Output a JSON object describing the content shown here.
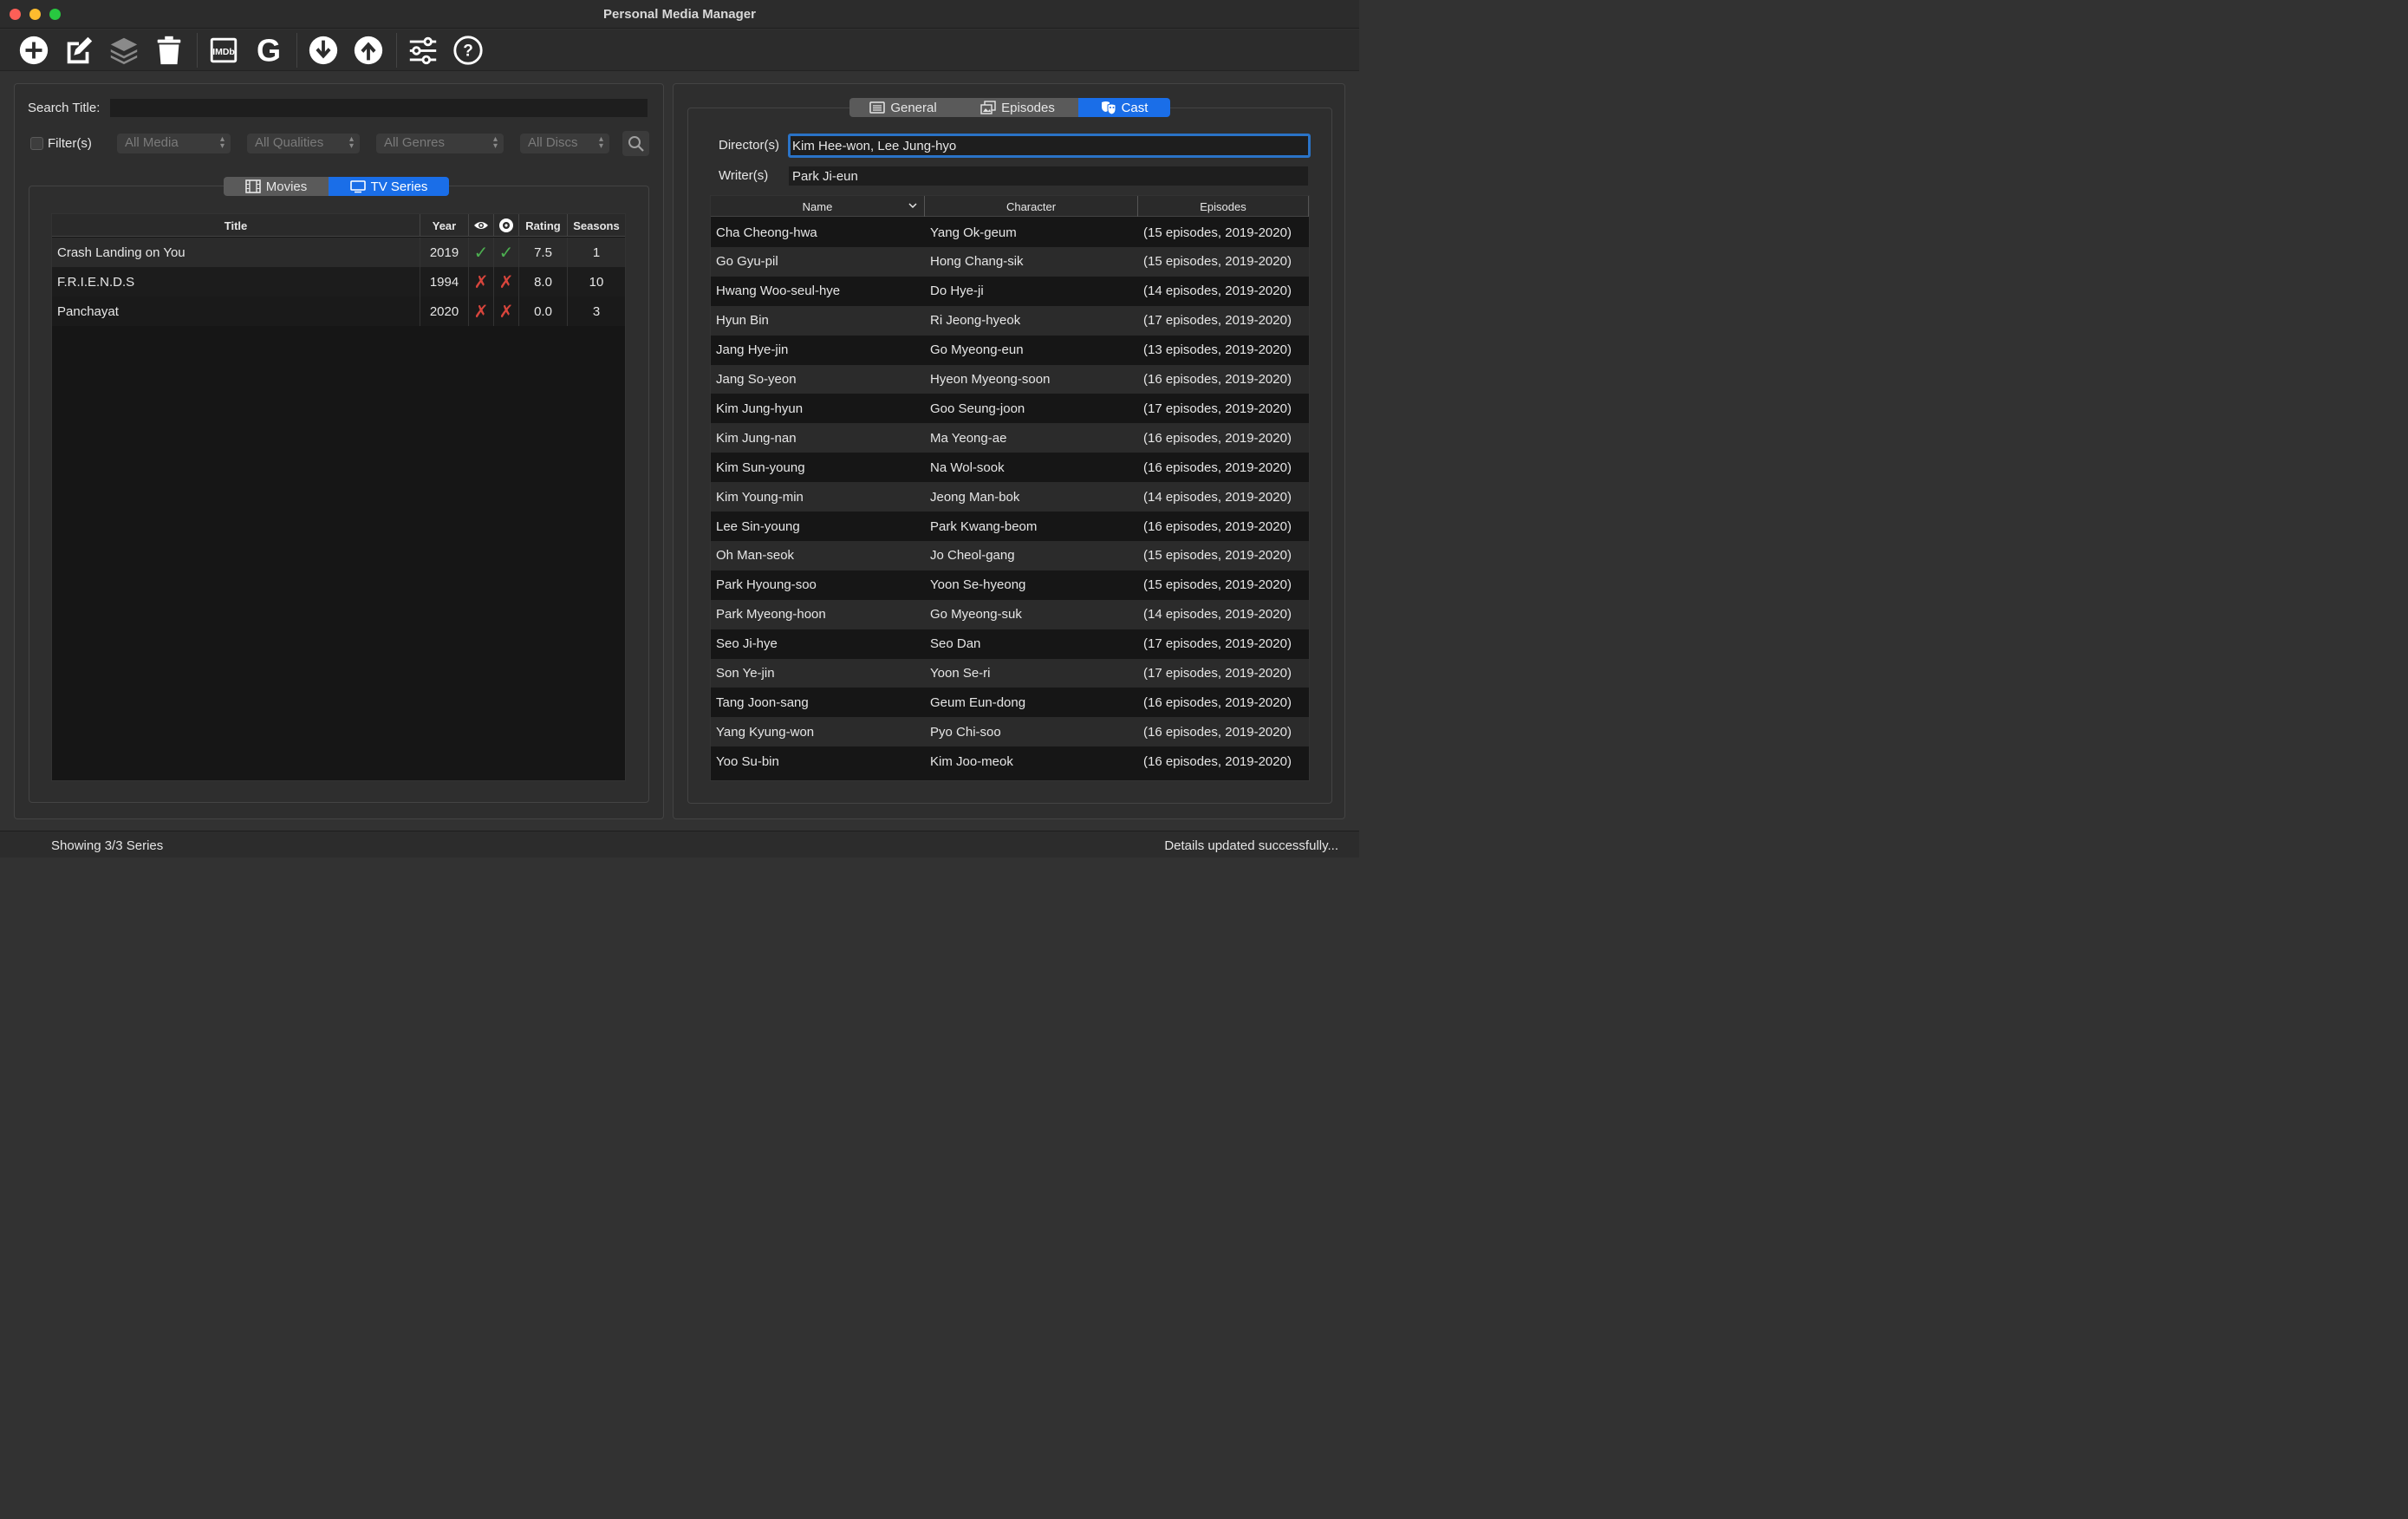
{
  "window": {
    "title": "Personal Media Manager"
  },
  "toolbar": {
    "buttons": [
      {
        "icon": "plus-circle-icon"
      },
      {
        "icon": "edit-icon"
      },
      {
        "icon": "layers-icon"
      },
      {
        "icon": "trash-icon"
      },
      {
        "icon": "imdb-icon",
        "label": "IMDb"
      },
      {
        "icon": "google-icon",
        "label": "G"
      },
      {
        "icon": "download-icon"
      },
      {
        "icon": "upload-icon"
      },
      {
        "icon": "sliders-icon"
      },
      {
        "icon": "help-icon"
      }
    ]
  },
  "search": {
    "label": "Search Title:",
    "value": ""
  },
  "filters": {
    "label": "Filter(s)",
    "checked": false,
    "media": "All Media",
    "qualities": "All Qualities",
    "genres": "All Genres",
    "discs": "All Discs"
  },
  "media_tabs": {
    "movies": "Movies",
    "tv_series": "TV Series",
    "active": "tv_series"
  },
  "series_table": {
    "headers": {
      "title": "Title",
      "year": "Year",
      "watched_icon": "eye-icon",
      "disc_icon": "disc-icon",
      "rating": "Rating",
      "seasons": "Seasons"
    },
    "rows": [
      {
        "title": "Crash Landing on You",
        "year": "2019",
        "watched": "✓",
        "owned": "✓",
        "rating": "7.5",
        "seasons": "1"
      },
      {
        "title": "F.R.I.E.N.D.S",
        "year": "1994",
        "watched": "✗",
        "owned": "✗",
        "rating": "8.0",
        "seasons": "10"
      },
      {
        "title": "Panchayat",
        "year": "2020",
        "watched": "✗",
        "owned": "✗",
        "rating": "0.0",
        "seasons": "3"
      }
    ]
  },
  "detail_tabs": {
    "general": "General",
    "episodes": "Episodes",
    "cast": "Cast",
    "active": "cast"
  },
  "credits": {
    "directors_label": "Director(s)",
    "directors_value": "Kim Hee-won, Lee Jung-hyo",
    "writers_label": "Writer(s)",
    "writers_value": "Park Ji-eun"
  },
  "cast_table": {
    "headers": {
      "name": "Name",
      "character": "Character",
      "episodes": "Episodes"
    },
    "rows": [
      {
        "name": "Cha Cheong-hwa",
        "character": "Yang Ok-geum",
        "episodes": "(15 episodes, 2019-2020)"
      },
      {
        "name": "Go Gyu-pil",
        "character": "Hong Chang-sik",
        "episodes": "(15 episodes, 2019-2020)"
      },
      {
        "name": "Hwang Woo-seul-hye",
        "character": "Do Hye-ji",
        "episodes": "(14 episodes, 2019-2020)"
      },
      {
        "name": "Hyun Bin",
        "character": "Ri Jeong-hyeok",
        "episodes": "(17 episodes, 2019-2020)"
      },
      {
        "name": "Jang Hye-jin",
        "character": "Go Myeong-eun",
        "episodes": "(13 episodes, 2019-2020)"
      },
      {
        "name": "Jang So-yeon",
        "character": "Hyeon Myeong-soon",
        "episodes": "(16 episodes, 2019-2020)"
      },
      {
        "name": "Kim Jung-hyun",
        "character": "Goo Seung-joon",
        "episodes": "(17 episodes, 2019-2020)"
      },
      {
        "name": "Kim Jung-nan",
        "character": "Ma Yeong-ae",
        "episodes": "(16 episodes, 2019-2020)"
      },
      {
        "name": "Kim Sun-young",
        "character": "Na Wol-sook",
        "episodes": "(16 episodes, 2019-2020)"
      },
      {
        "name": "Kim Young-min",
        "character": "Jeong Man-bok",
        "episodes": "(14 episodes, 2019-2020)"
      },
      {
        "name": "Lee Sin-young",
        "character": "Park Kwang-beom",
        "episodes": "(16 episodes, 2019-2020)"
      },
      {
        "name": "Oh Man-seok",
        "character": "Jo Cheol-gang",
        "episodes": "(15 episodes, 2019-2020)"
      },
      {
        "name": "Park Hyoung-soo",
        "character": "Yoon Se-hyeong",
        "episodes": "(15 episodes, 2019-2020)"
      },
      {
        "name": "Park Myeong-hoon",
        "character": "Go Myeong-suk",
        "episodes": "(14 episodes, 2019-2020)"
      },
      {
        "name": "Seo Ji-hye",
        "character": "Seo Dan",
        "episodes": "(17 episodes, 2019-2020)"
      },
      {
        "name": "Son Ye-jin",
        "character": "Yoon Se-ri",
        "episodes": "(17 episodes, 2019-2020)"
      },
      {
        "name": "Tang Joon-sang",
        "character": "Geum Eun-dong",
        "episodes": "(16 episodes, 2019-2020)"
      },
      {
        "name": "Yang Kyung-won",
        "character": "Pyo Chi-soo",
        "episodes": "(16 episodes, 2019-2020)"
      },
      {
        "name": "Yoo Su-bin",
        "character": "Kim Joo-meok",
        "episodes": "(16 episodes, 2019-2020)"
      }
    ]
  },
  "status": {
    "left": "Showing 3/3 Series",
    "right": "Details updated successfully..."
  },
  "colors": {
    "accent": "#1a6ee8",
    "check": "#4caf50",
    "cross": "#d8453c"
  }
}
